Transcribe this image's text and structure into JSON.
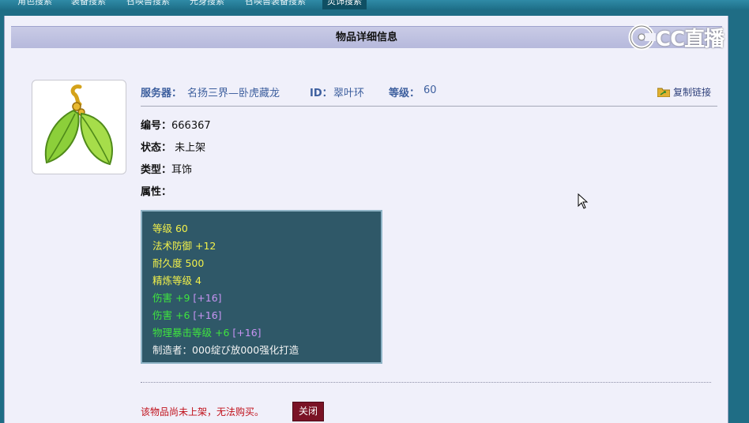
{
  "nav": {
    "tabs": [
      {
        "label": "角色搜索"
      },
      {
        "label": "装备搜索"
      },
      {
        "label": "召唤兽搜索"
      },
      {
        "label": "元身搜索"
      },
      {
        "label": "召唤兽装备搜索"
      },
      {
        "label": "灵饰搜索"
      }
    ]
  },
  "title": "物品详细信息",
  "header": {
    "server_label": "服务器：",
    "server_value": "名扬三界—卧虎藏龙",
    "id_label": "ID：",
    "id_value": "翠叶环",
    "level_label": "等级：",
    "level_value": "60",
    "copy_link": "复制链接"
  },
  "fields": {
    "number_label": "编号：",
    "number_value": "666367",
    "status_label": "状态：",
    "status_value": "未上架",
    "type_label": "类型：",
    "type_value": "耳饰",
    "attributes_label": "属性："
  },
  "attributes": {
    "level": "等级 60",
    "magic_def": "法术防御 +12",
    "durability": "耐久度 500",
    "refine": "精炼等级 4",
    "dmg1": "伤害 +9",
    "dmg1_bonus": "[+16]",
    "dmg2": "伤害 +6",
    "dmg2_bonus": "[+16]",
    "crit": "物理暴击等级 +6",
    "crit_bonus": "[+16]",
    "maker": "制造者：000绽び放000强化打造"
  },
  "notice": "该物品尚未上架，无法购买。",
  "close_button": "关闭",
  "watermark": "CC直播",
  "colors": {
    "attr_bg": "#2f5868",
    "attr_yellow": "#f2f04a",
    "attr_green": "#3fe33f",
    "attr_purple": "#c794f2",
    "notice_red": "#c0101a",
    "close_btn": "#7a1325",
    "header_blue": "#3d5f9e"
  },
  "icons": {
    "item_image": "leaf-earring-icon",
    "copy": "folder-link-icon",
    "cursor": "mouse-pointer-icon",
    "watermark_logo": "cc-live-logo-icon"
  }
}
